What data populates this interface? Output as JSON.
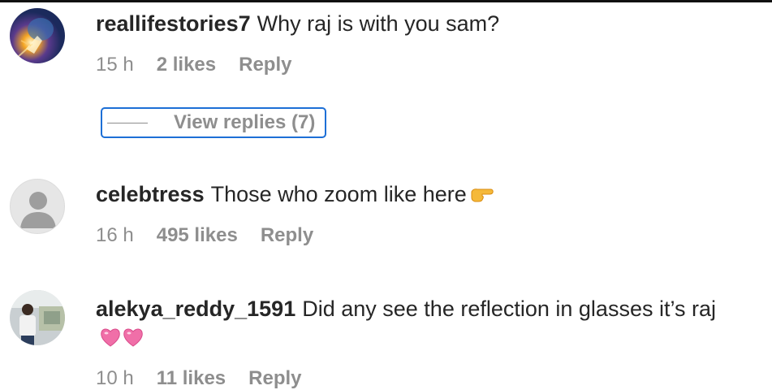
{
  "comments": [
    {
      "username": "reallifestories7",
      "text": "Why raj is with you sam?",
      "time": "15 h",
      "likes": "2 likes",
      "reply": "Reply",
      "avatar_icon": "lightbulb-photo-avatar",
      "view_replies": "View replies (7)"
    },
    {
      "username": "celebtress",
      "text": "Those who zoom like here",
      "emoji": "backhand-index-pointing-right",
      "time": "16 h",
      "likes": "495 likes",
      "reply": "Reply",
      "avatar_icon": "default-user-avatar"
    },
    {
      "username": "alekya_reddy_1591",
      "text": "Did any see the reflection in glasses it’s raj",
      "emoji": "two-hearts",
      "time": "10 h",
      "likes": "11 likes",
      "reply": "Reply",
      "avatar_icon": "person-photo-avatar"
    }
  ],
  "colors": {
    "text": "#262626",
    "meta": "#8e8e8e",
    "focus_outline": "#1d6fd6",
    "heart": "#f06fa8"
  }
}
